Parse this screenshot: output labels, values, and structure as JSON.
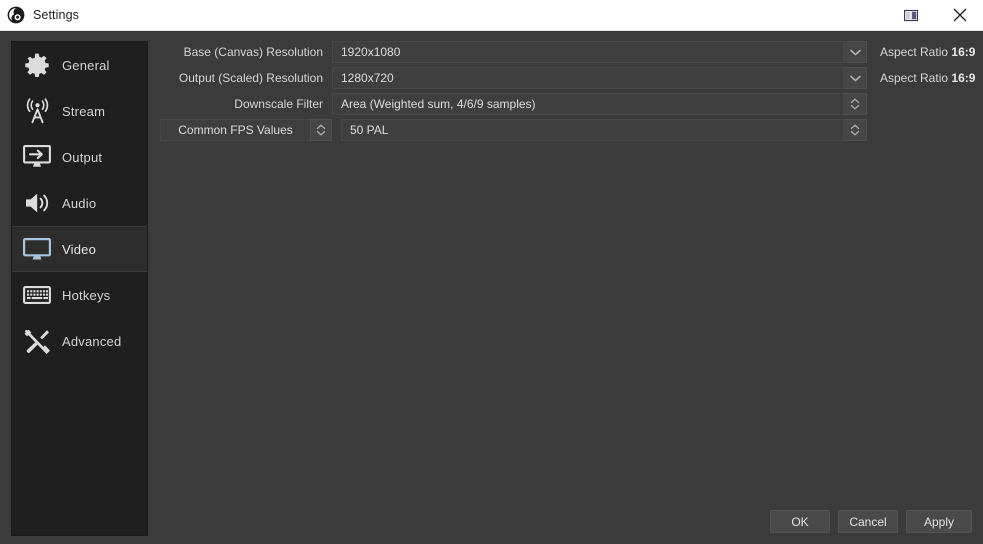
{
  "window": {
    "title": "Settings",
    "logo_icon": "obs-logo-icon",
    "dock_icon": "dock-restore-icon",
    "close_icon": "close-icon"
  },
  "sidebar": {
    "items": [
      {
        "label": "General",
        "icon": "gear-icon",
        "selected": false
      },
      {
        "label": "Stream",
        "icon": "broadcast-icon",
        "selected": false
      },
      {
        "label": "Output",
        "icon": "output-icon",
        "selected": false
      },
      {
        "label": "Audio",
        "icon": "speaker-icon",
        "selected": false
      },
      {
        "label": "Video",
        "icon": "monitor-icon",
        "selected": true
      },
      {
        "label": "Hotkeys",
        "icon": "keyboard-icon",
        "selected": false
      },
      {
        "label": "Advanced",
        "icon": "tools-icon",
        "selected": false
      }
    ]
  },
  "video_settings": {
    "base_resolution": {
      "label": "Base (Canvas) Resolution",
      "value": "1920x1080",
      "aspect_label": "Aspect Ratio",
      "aspect_value": "16:9",
      "control": "combobox",
      "arrow_icon": "chevron-down-icon"
    },
    "output_resolution": {
      "label": "Output (Scaled) Resolution",
      "value": "1280x720",
      "aspect_label": "Aspect Ratio",
      "aspect_value": "16:9",
      "control": "combobox",
      "arrow_icon": "chevron-down-icon"
    },
    "downscale_filter": {
      "label": "Downscale Filter",
      "value": "Area (Weighted sum, 4/6/9 samples)",
      "control": "spinbox",
      "spin_icon": "spinner-up-down-icon"
    },
    "fps": {
      "label": "Common FPS Values",
      "label_control": "combobox",
      "label_spin_icon": "spinner-up-down-icon",
      "value": "50 PAL",
      "control": "spinbox",
      "spin_icon": "spinner-up-down-icon"
    }
  },
  "footer": {
    "ok_label": "OK",
    "cancel_label": "Cancel",
    "apply_label": "Apply"
  },
  "colors": {
    "window_bg": "#3b3b3b",
    "sidebar_bg": "#1f1f1f",
    "sidebar_selected_bg": "#2d2d2d",
    "field_bg": "#3f3f3f",
    "titlebar_bg": "#ffffff",
    "text": "#d6d6d6",
    "accent_icon": "#a8c4e0"
  }
}
